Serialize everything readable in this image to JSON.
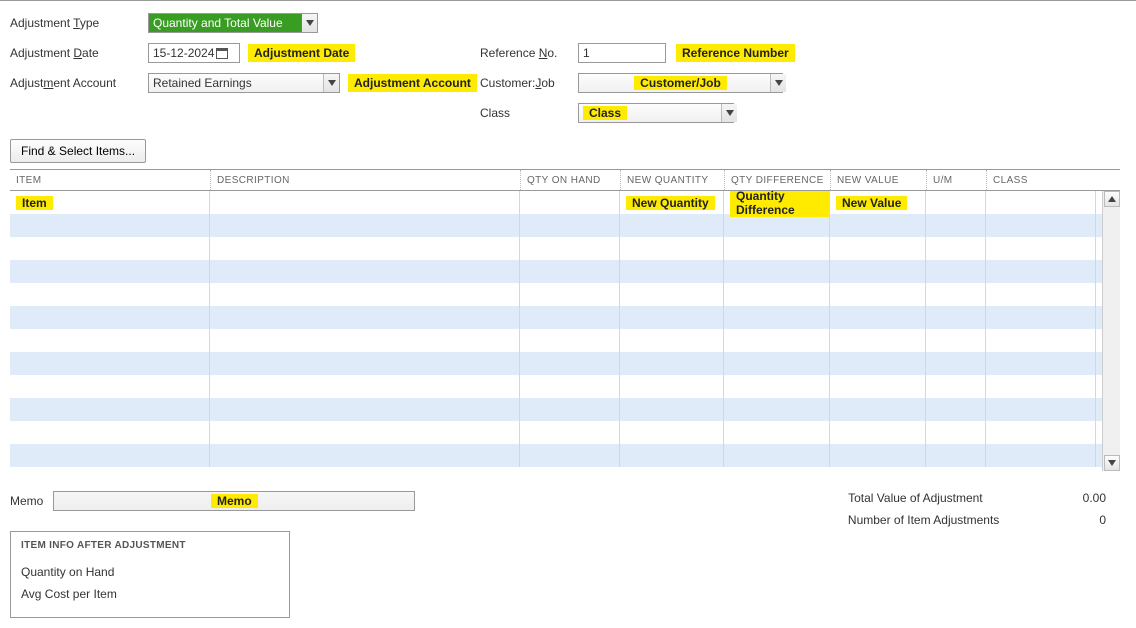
{
  "form": {
    "adj_type_label": "Adjustment Type",
    "adj_type_underline": "T",
    "adj_type_value": "Quantity and Total Value",
    "adj_date_label": "Adjustment Date",
    "adj_date_underline": "D",
    "adj_date_value": "15-12-2024",
    "adj_date_highlight": "Adjustment Date",
    "ref_no_label": "Reference No.",
    "ref_no_underline": "N",
    "ref_no_value": "1",
    "ref_no_highlight": "Reference Number",
    "adj_account_label": "Adjustment Account",
    "adj_account_underline": "m",
    "adj_account_value": "Retained Earnings",
    "adj_account_highlight": "Adjustment Account",
    "customer_label": "Customer:Job",
    "customer_underline": "J",
    "customer_highlight": "Customer/Job",
    "class_label": "Class",
    "class_highlight": "Class",
    "find_button": "Find & Select Items..."
  },
  "grid": {
    "headers": {
      "item": "Item",
      "description": "Description",
      "qty_on_hand": "Qty on Hand",
      "new_quantity": "New Quantity",
      "qty_difference": "Qty Difference",
      "new_value": "New Value",
      "um": "U/M",
      "class": "Class"
    },
    "annotations": {
      "item": "Item",
      "new_quantity": "New Quantity",
      "qty_difference": "Quantity Difference",
      "new_value": "New Value"
    }
  },
  "memo": {
    "label": "Memo",
    "highlight": "Memo"
  },
  "totals": {
    "total_value_label": "Total Value of Adjustment",
    "total_value": "0.00",
    "num_adjustments_label": "Number of Item Adjustments",
    "num_adjustments": "0"
  },
  "item_info": {
    "header": "ITEM INFO AFTER ADJUSTMENT",
    "qty_on_hand": "Quantity on Hand",
    "avg_cost": "Avg Cost per Item"
  }
}
